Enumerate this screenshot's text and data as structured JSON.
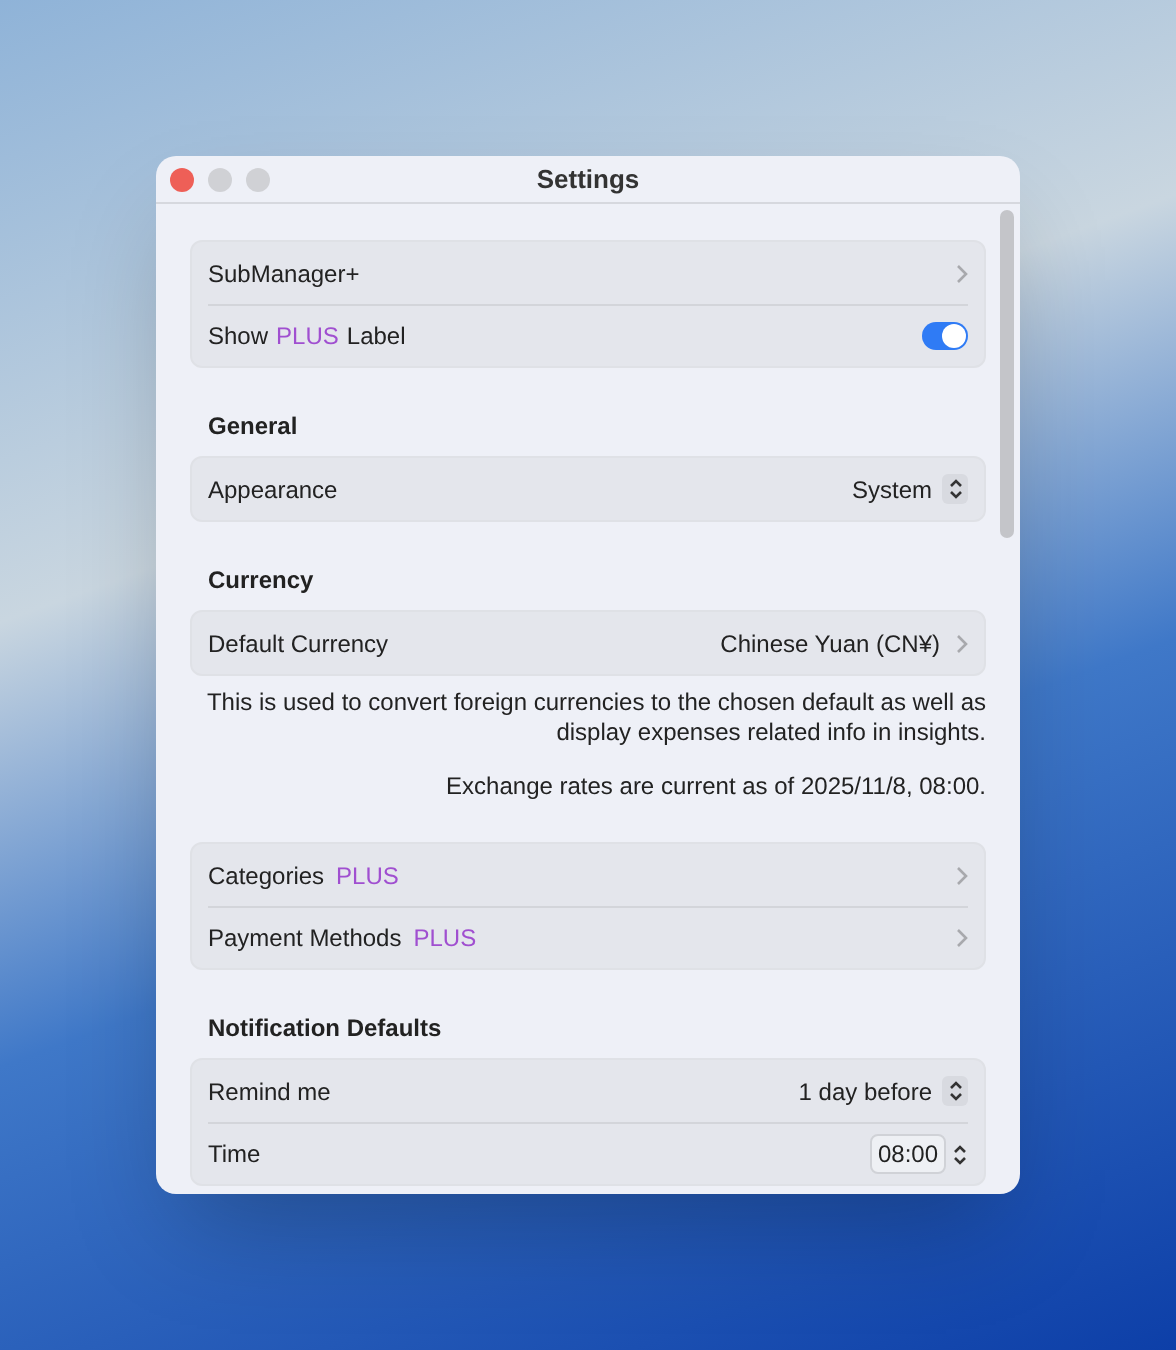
{
  "window": {
    "title": "Settings"
  },
  "sections": [
    {
      "rows": [
        {
          "kind": "link",
          "label": "SubManager+"
        },
        {
          "kind": "toggle",
          "label": "Show",
          "badge": "PLUS",
          "label_after": "Label",
          "on": true
        }
      ]
    },
    {
      "heading": "General",
      "rows": [
        {
          "kind": "popup",
          "label": "Appearance",
          "value": "System"
        }
      ]
    },
    {
      "heading": "Currency",
      "rows": [
        {
          "kind": "link",
          "label": "Default Currency",
          "value": "Chinese Yuan (CN¥)"
        }
      ],
      "notes": [
        "This is used to convert foreign currencies to the chosen default as well as display expenses related info in insights.",
        "Exchange rates are current as of 2025/11/8, 08:00."
      ]
    },
    {
      "rows": [
        {
          "kind": "link",
          "label": "Categories",
          "badge": "PLUS"
        },
        {
          "kind": "link",
          "label": "Payment Methods",
          "badge": "PLUS"
        }
      ]
    },
    {
      "heading": "Notification Defaults",
      "rows": [
        {
          "kind": "popup",
          "label": "Remind me",
          "value": "1 day before"
        },
        {
          "kind": "stepper",
          "label": "Time",
          "value": "08:00"
        }
      ]
    }
  ]
}
